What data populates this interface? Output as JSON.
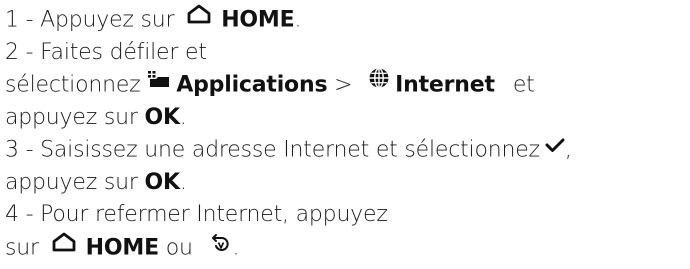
{
  "steps": [
    {
      "prefix": "1 -  Appuyez sur ",
      "icon": "home-icon",
      "key": "HOME",
      "suffix": "."
    },
    {
      "line1": "2 -  Faites défiler et",
      "line2_prefix": "sélectionnez ",
      "apps_icon": "applications-icon",
      "apps_label": "Applications",
      "separator": " > ",
      "globe_icon": "globe-icon",
      "internet_label": "Internet",
      "line2_suffix": "et",
      "line3_prefix": "appuyez sur ",
      "ok_label": "OK",
      "line3_suffix": "."
    },
    {
      "line1": "3 -  Saisissez une adresse Internet et sélectionnez",
      "check_icon": "checkmark-icon",
      "line1_suffix": ",",
      "line2_prefix": "appuyez sur ",
      "ok_label": "OK",
      "line2_suffix": "."
    },
    {
      "line1": "4 -  Pour refermer Internet, appuyez",
      "line2_prefix": "sur ",
      "home_icon": "home-icon",
      "home_label": "HOME",
      "or_text": " ou ",
      "back_icon": "back-icon",
      "line2_suffix": "."
    }
  ]
}
